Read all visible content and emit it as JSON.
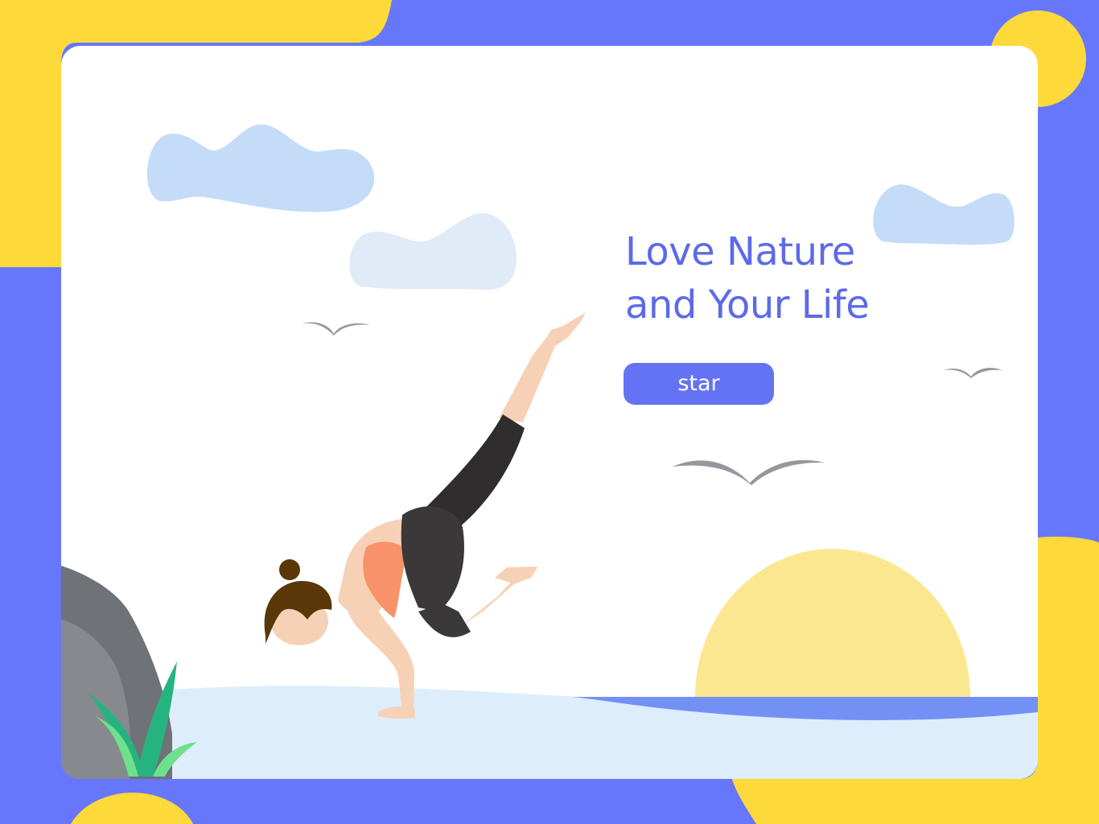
{
  "hero": {
    "headline_line1": "Love Nature",
    "headline_line2": "and Your Life",
    "cta_label": "star"
  },
  "colors": {
    "frame_blue": "#6677fc",
    "accent_yellow": "#fdda3a",
    "card_white": "#ffffff",
    "headline": "#5c6ae8",
    "button": "#6473f3",
    "button_text": "#ffffff",
    "cloud_blue": "#c5dcf8",
    "cloud_light": "#e1ebf7",
    "sun": "#fbe78f",
    "ground": "#deedfc",
    "sea": "#7391f4",
    "rock_dark": "#6f7277",
    "rock_light": "#86898e",
    "grass": "#25b47f",
    "grass_light": "#6fe08c",
    "bird": "#94989e",
    "skin": "#f7d1b6",
    "hair": "#5a3708",
    "top": "#f7926a",
    "leggings": "#3a3838"
  },
  "icons": {
    "cta": "none",
    "decor": [
      "cloud",
      "bird",
      "sun",
      "rock",
      "grass",
      "yoga-figure"
    ]
  }
}
